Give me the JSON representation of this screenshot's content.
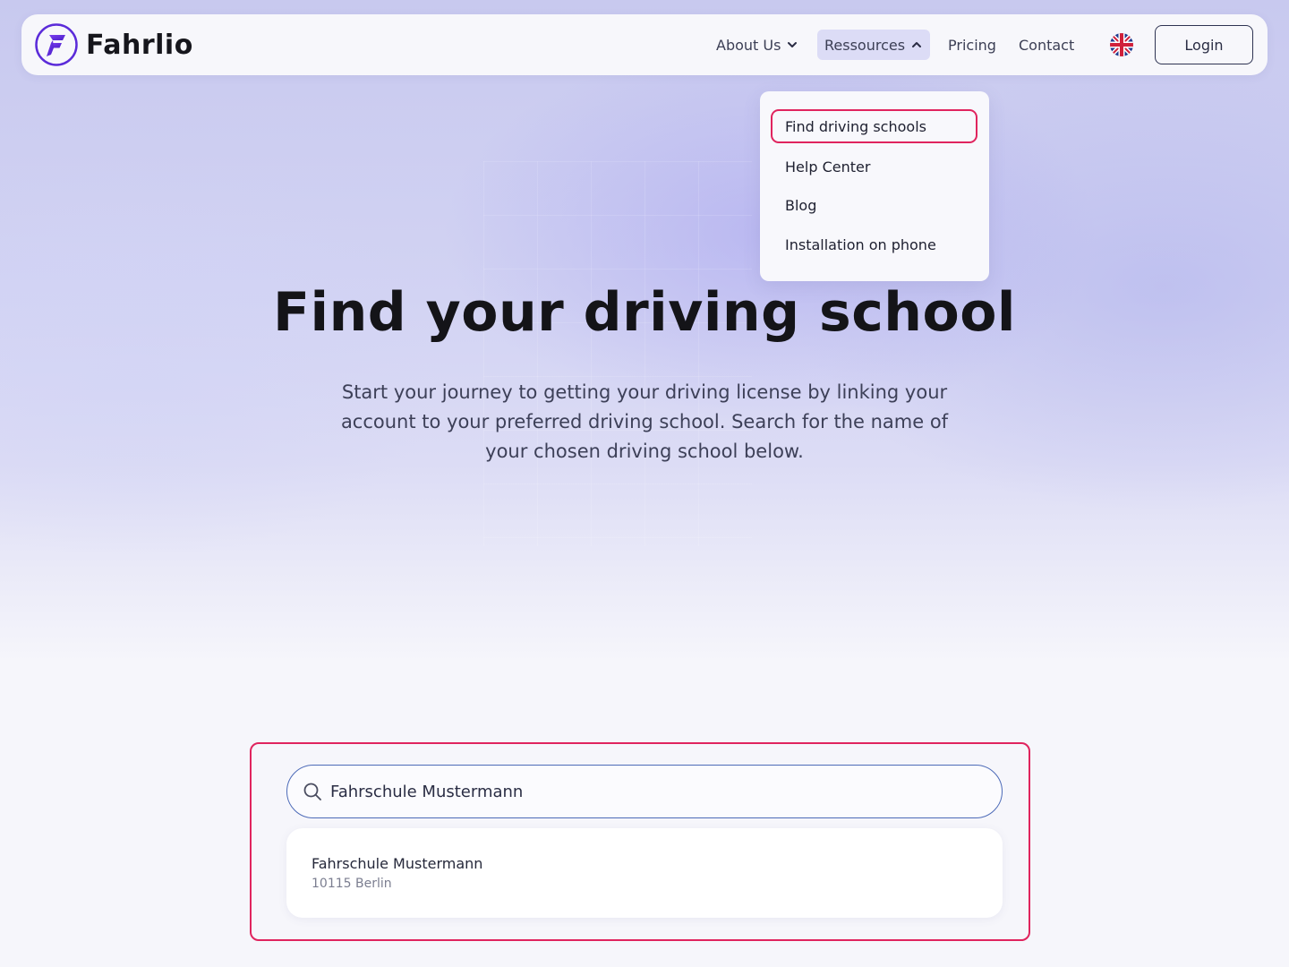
{
  "brand": {
    "name": "Fahrlio",
    "accent": "#5b2bd9",
    "highlight": "#e0245e"
  },
  "nav": {
    "items": [
      {
        "label": "About Us",
        "icon": "chevron-down-icon"
      },
      {
        "label": "Ressources",
        "icon": "chevron-up-icon"
      },
      {
        "label": "Pricing"
      },
      {
        "label": "Contact"
      }
    ],
    "language_icon": "uk-flag-icon",
    "login_label": "Login"
  },
  "dropdown": {
    "items": [
      {
        "label": "Find driving schools",
        "active": true
      },
      {
        "label": "Help Center"
      },
      {
        "label": "Blog"
      },
      {
        "label": "Installation on phone"
      }
    ]
  },
  "hero": {
    "title": "Find your driving school",
    "subtitle": "Start your journey to getting your driving license by linking your account to your preferred driving school. Search for the name of your chosen driving school below."
  },
  "search": {
    "icon": "search-icon",
    "value": "Fahrschule Mustermann",
    "placeholder": "",
    "results": [
      {
        "name": "Fahrschule Mustermann",
        "address": "10115 Berlin"
      }
    ]
  }
}
